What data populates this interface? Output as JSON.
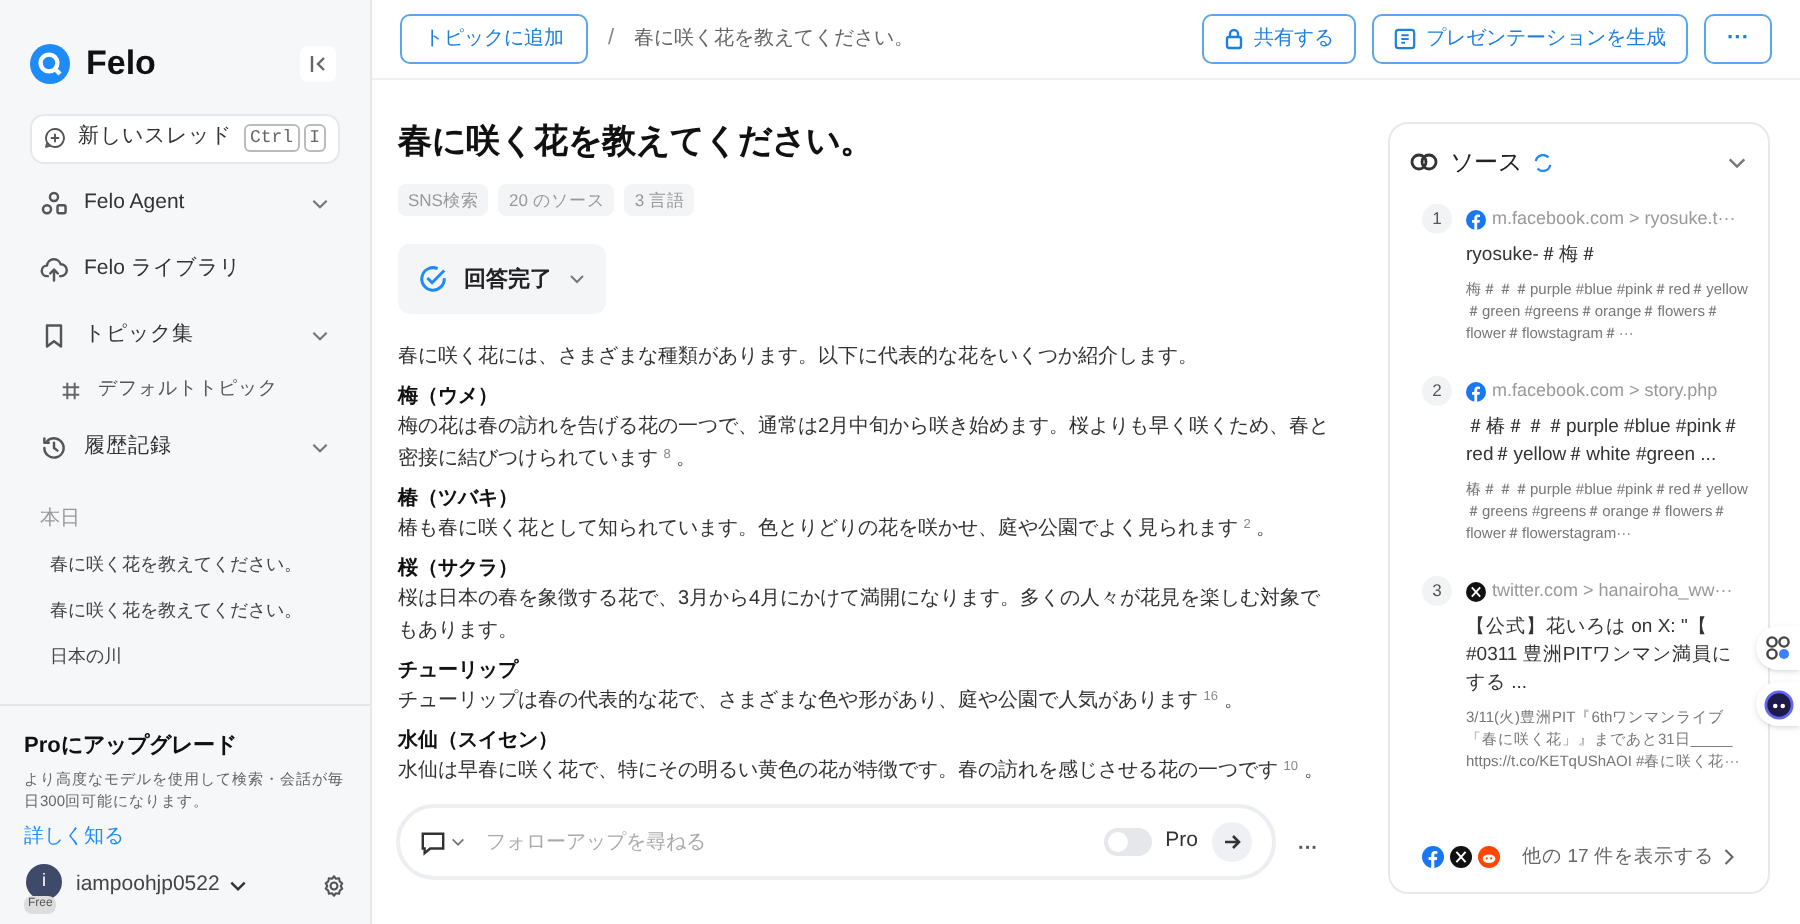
{
  "brand": {
    "name": "Felo"
  },
  "sidebar": {
    "new_thread": {
      "label": "新しいスレッド",
      "keys": [
        "Ctrl",
        "I"
      ]
    },
    "items": [
      {
        "kind": "agent",
        "label": "Felo Agent",
        "expandable": true
      },
      {
        "kind": "library",
        "label": "Felo ライブラリ",
        "expandable": false
      },
      {
        "kind": "topics",
        "label": "トピック集",
        "expandable": true,
        "children": [
          {
            "label": "デフォルトトピック"
          }
        ]
      },
      {
        "kind": "history",
        "label": "履歴記録",
        "expandable": true
      }
    ],
    "history_group": "本日",
    "history": [
      "春に咲く花を教えてください。",
      "春に咲く花を教えてください。",
      "日本の川"
    ],
    "upgrade": {
      "title": "Proにアップグレード",
      "text": "より高度なモデルを使用して検索・会話が毎日300回可能になります。",
      "link": "詳しく知る"
    },
    "user": {
      "avatar": "i",
      "plan": "Free",
      "name": "iampoohjp0522"
    }
  },
  "header": {
    "add_topic": "トピックに追加",
    "separator": "/",
    "breadcrumb": "春に咲く花を教えてください。",
    "share": "共有する",
    "presentation": "プレゼンテーションを生成",
    "more": "···"
  },
  "question": {
    "title": "春に咲く花を教えてください。",
    "tags": [
      "SNS検索",
      "20 のソース",
      "3 言語"
    ],
    "status": "回答完了"
  },
  "answer": [
    {
      "kind": "text",
      "text": "春に咲く花には、さまざまな種類があります。以下に代表的な花をいくつか紹介します。"
    },
    {
      "kind": "heading",
      "text": "梅（ウメ）"
    },
    {
      "kind": "text",
      "text": "梅の花は春の訪れを告げる花の一つで、通常は2月中旬から咲き始めます。桜よりも早く咲くため、春と密接に結びつけられています $^{8}$ 。"
    },
    {
      "kind": "heading",
      "text": "椿（ツバキ）"
    },
    {
      "kind": "text",
      "text": "椿も春に咲く花として知られています。色とりどりの花を咲かせ、庭や公園でよく見られます $^{2}$ 。"
    },
    {
      "kind": "heading",
      "text": "桜（サクラ）"
    },
    {
      "kind": "text",
      "text": "桜は日本の春を象徴する花で、3月から4月にかけて満開になります。多くの人々が花見を楽しむ対象でもあります。"
    },
    {
      "kind": "heading",
      "text": "チューリップ"
    },
    {
      "kind": "text",
      "text": "チューリップは春の代表的な花で、さまざまな色や形があり、庭や公園で人気があります $^{16}$ 。"
    },
    {
      "kind": "heading",
      "text": "水仙（スイセン）"
    },
    {
      "kind": "text",
      "text": "水仙は早春に咲く花で、特にその明るい黄色の花が特徴です。春の訪れを感じさせる花の一つです $^{10}$ 。"
    }
  ],
  "followup": {
    "placeholder": "フォローアップを尋ねる",
    "pro_label": "Pro",
    "pro_on": false,
    "more": "···"
  },
  "sources": {
    "title": "ソース",
    "items": [
      {
        "number": "1",
        "kind": "facebook",
        "url": "m.facebook.com > ryosuke.t···",
        "title": "ryosuke-＃梅＃",
        "snippet": "梅＃＃＃purple #blue #pink＃red＃yellow＃green #greens＃orange＃flowers＃flower＃flowstagram＃···"
      },
      {
        "number": "2",
        "kind": "facebook",
        "url": "m.facebook.com > story.php",
        "title": "＃椿＃＃＃purple #blue #pink＃red＃yellow＃white #green ...",
        "snippet": "椿＃＃＃purple #blue #pink＃red＃yellow＃greens #greens＃orange＃flowers＃flower＃flowerstagram···"
      },
      {
        "number": "3",
        "kind": "x",
        "url": "twitter.com > hanairoha_ww···",
        "title": "【公式】花いろは on X: \"【 #0311 豊洲PITワンマン満員にする ...",
        "snippet": "3/11(火)豊洲PIT『6thワンマンライブ「春に咲く花」』まであと31日_____ https://t.co/KETqUShAOI #春に咲く花···"
      }
    ],
    "footer_sites": [
      {
        "kind": "facebook"
      },
      {
        "kind": "x"
      },
      {
        "kind": "reddit"
      }
    ],
    "more": "他の 17 件を表示する"
  }
}
